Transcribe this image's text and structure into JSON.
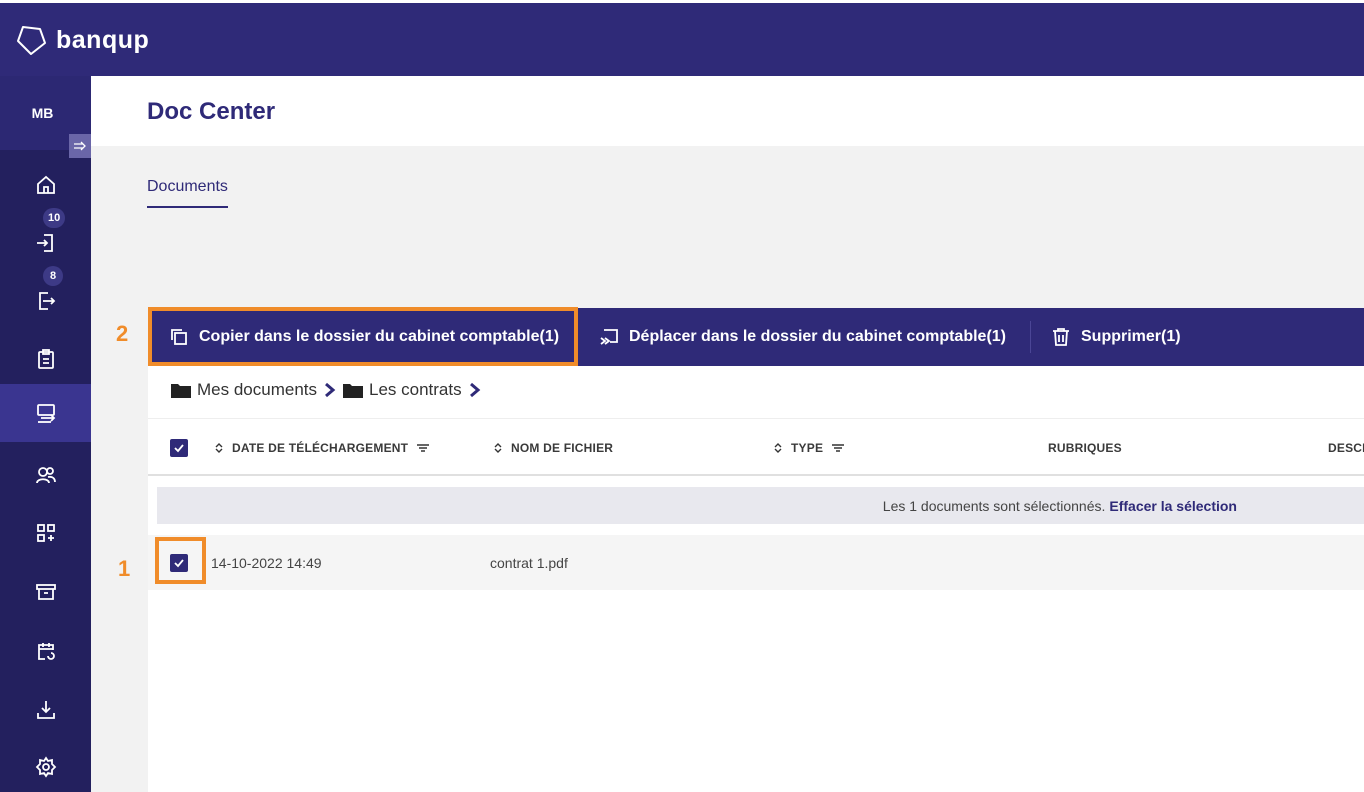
{
  "app": {
    "brand": "banqup",
    "brand_color": "#2f2a78",
    "highlight_color": "#f08c2a"
  },
  "user": {
    "initials": "MB"
  },
  "sidebar": {
    "collapse_icon": "arrow-right-icon",
    "items": [
      {
        "name": "home",
        "icon": "home-icon",
        "badge": ""
      },
      {
        "name": "incoming",
        "icon": "login-icon",
        "badge": "10"
      },
      {
        "name": "outgoing",
        "icon": "logout-icon",
        "badge": "8"
      },
      {
        "name": "clipboard",
        "icon": "clipboard-icon",
        "badge": ""
      },
      {
        "name": "doc-center",
        "icon": "transfer-icon",
        "badge": "",
        "active": true
      },
      {
        "name": "contacts",
        "icon": "users-icon",
        "badge": ""
      },
      {
        "name": "apps",
        "icon": "apps-add-icon",
        "badge": ""
      },
      {
        "name": "archive",
        "icon": "archive-icon",
        "badge": ""
      },
      {
        "name": "calendar",
        "icon": "calendar-sync-icon",
        "badge": ""
      },
      {
        "name": "download",
        "icon": "download-icon",
        "badge": ""
      },
      {
        "name": "settings",
        "icon": "gear-icon",
        "badge": ""
      }
    ]
  },
  "header": {
    "title": "Doc Center"
  },
  "tabs": [
    {
      "label": "Documents",
      "active": true
    }
  ],
  "steps": {
    "one": "1",
    "two": "2"
  },
  "actions": {
    "copy": "Copier dans le dossier du cabinet comptable(1)",
    "move": "Déplacer dans le dossier du cabinet comptable(1)",
    "delete": "Supprimer(1)"
  },
  "breadcrumb": {
    "root": "Mes documents",
    "folder": "Les contrats"
  },
  "table": {
    "columns": {
      "date": "DATE DE TÉLÉCHARGEMENT",
      "filename": "NOM DE FICHIER",
      "type": "TYPE",
      "rubriques": "RUBRIQUES",
      "description": "DESCR"
    },
    "selection": {
      "text": "Les 1 documents sont sélectionnés.",
      "clear": "Effacer la sélection"
    },
    "rows": [
      {
        "checked": true,
        "date": "14-10-2022 14:49",
        "filename": "contrat 1.pdf",
        "type": "",
        "rubriques": ""
      }
    ]
  }
}
